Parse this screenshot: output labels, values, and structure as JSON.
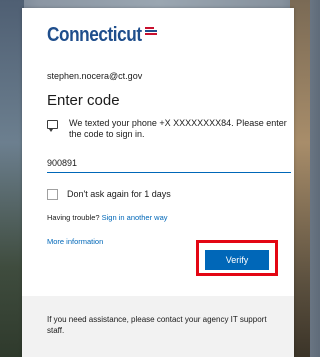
{
  "brand": {
    "logo_text": "Connecticut"
  },
  "account": {
    "email": "stephen.nocera@ct.gov"
  },
  "page": {
    "title": "Enter code"
  },
  "message": {
    "text": "We texted your phone +X XXXXXXXX84. Please enter the code to sign in."
  },
  "code_input": {
    "value": "900891"
  },
  "remember": {
    "label": "Don't ask again for 1 days",
    "checked": false
  },
  "trouble": {
    "prefix": "Having trouble?",
    "link": "Sign in another way"
  },
  "more_info": {
    "link": "More information"
  },
  "actions": {
    "verify_label": "Verify"
  },
  "footer": {
    "text": "If you need assistance, please contact your agency IT support staff."
  },
  "colors": {
    "accent": "#0067b8",
    "brand": "#1f4e8c",
    "highlight_box": "#e30613",
    "footer_bg": "#f2f2f2"
  },
  "icons": {
    "message": "sms-message-icon",
    "flag": "connecticut-flag-icon"
  }
}
